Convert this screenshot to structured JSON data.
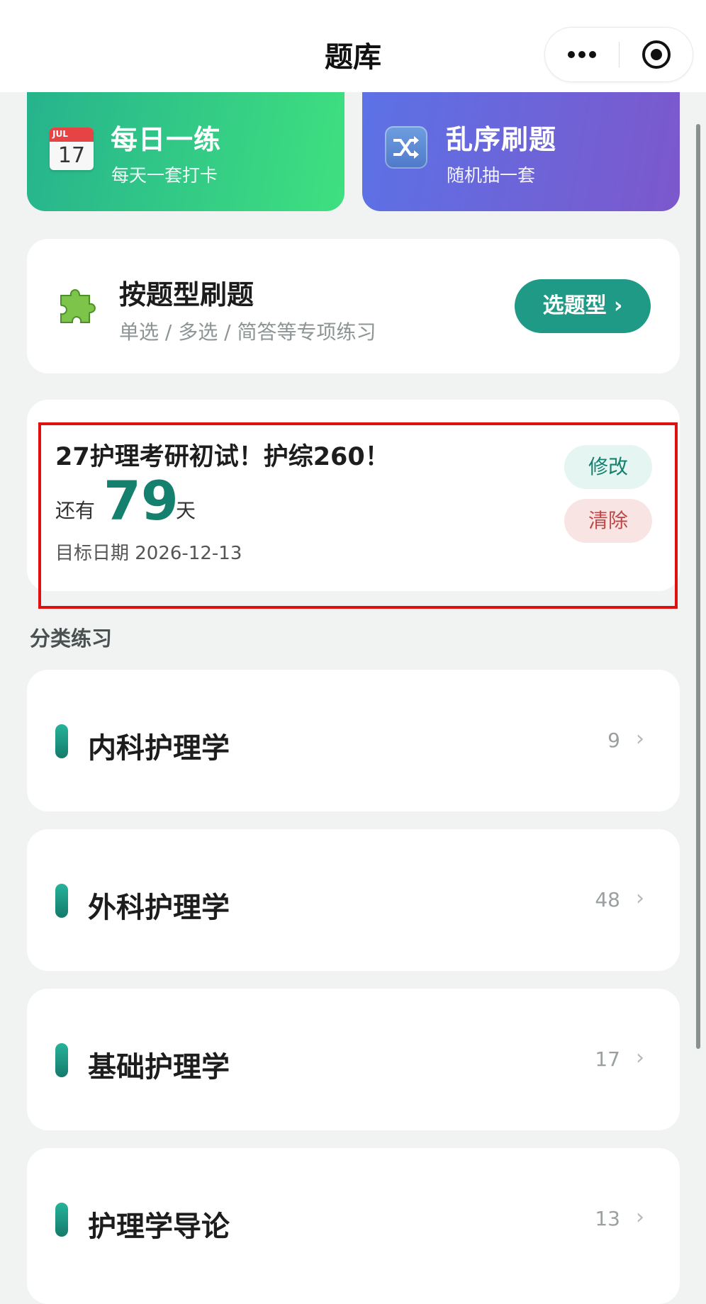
{
  "header": {
    "title": "题库"
  },
  "feature_cards": [
    {
      "icon": "calendar-icon",
      "icon_month": "JUL",
      "icon_day": "17",
      "title": "每日一练",
      "subtitle": "每天一套打卡"
    },
    {
      "icon": "shuffle-icon",
      "title": "乱序刷题",
      "subtitle": "随机抽一套"
    }
  ],
  "type_practice": {
    "icon": "puzzle-icon",
    "title": "按题型刷题",
    "subtitle": "单选 / 多选 / 简答等专项练习",
    "button_label": "选题型 ›"
  },
  "countdown": {
    "title": "27护理考研初试！护综260！",
    "prefix": "还有",
    "days": "79",
    "unit": "天",
    "target_date": "目标日期 2026-12-13",
    "edit_label": "修改",
    "clear_label": "清除"
  },
  "categories_section": {
    "label": "分类练习",
    "items": [
      {
        "name": "内科护理学",
        "count": "9"
      },
      {
        "name": "外科护理学",
        "count": "48"
      },
      {
        "name": "基础护理学",
        "count": "17"
      },
      {
        "name": "护理学导论",
        "count": "13"
      }
    ]
  },
  "colors": {
    "accent": "#1f9a86",
    "daily_gradient": [
      "#26b38d",
      "#3fe07f"
    ],
    "random_gradient": [
      "#5b72e6",
      "#7c58cc"
    ],
    "highlight_border": "#e01010",
    "clear_text": "#c04848"
  }
}
